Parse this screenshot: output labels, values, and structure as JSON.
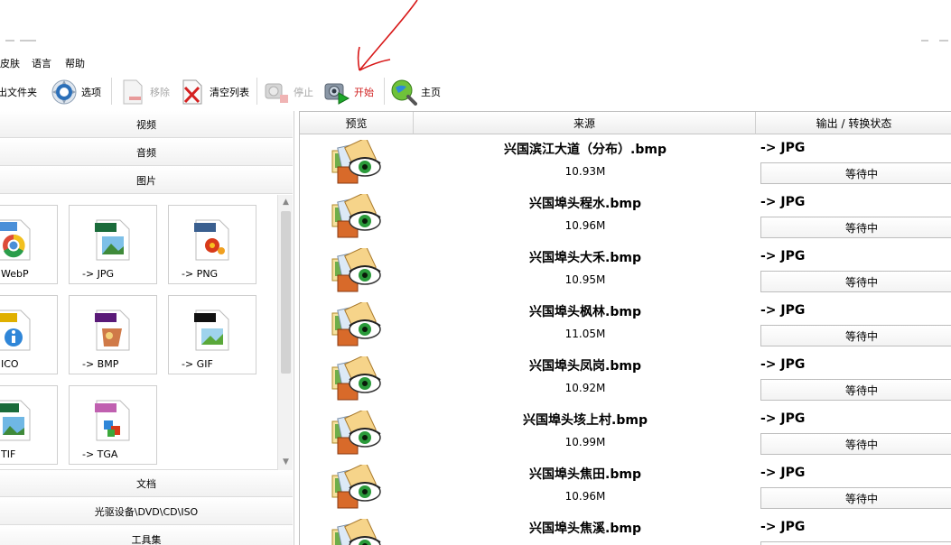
{
  "menu": [
    "皮肤",
    "语言",
    "帮助"
  ],
  "toolbar": {
    "output_folder": "输出文件夹",
    "options": "选项",
    "remove": "移除",
    "clear_list": "清空列表",
    "stop": "停止",
    "start": "开始",
    "home": "主页"
  },
  "left": {
    "categories_top": [
      "视频",
      "音频",
      "图片"
    ],
    "categories_bottom": [
      "文档",
      "光驱设备\\DVD\\CD\\ISO",
      "工具集"
    ],
    "formats": [
      {
        "label": "WebP",
        "badge": "WebP",
        "badge_color": "#4a8fd8"
      },
      {
        "label": "-> JPG",
        "badge": "JPG",
        "badge_color": "#1a6b3a"
      },
      {
        "label": "-> PNG",
        "badge": "PNG",
        "badge_color": "#3a5f8f"
      },
      {
        "label": "ICO",
        "badge": "ICO",
        "badge_color": "#e0b000"
      },
      {
        "label": "-> BMP",
        "badge": "BMP",
        "badge_color": "#5a1a78"
      },
      {
        "label": "-> GIF",
        "badge": "GIF",
        "badge_color": "#111111"
      },
      {
        "label": "TIF",
        "badge": "TIFF",
        "badge_color": "#1a6b3a"
      },
      {
        "label": "-> TGA",
        "badge": "TGA",
        "badge_color": "#c060b0"
      }
    ]
  },
  "table": {
    "headers": [
      "预览",
      "来源",
      "输出 / 转换状态"
    ],
    "rows": [
      {
        "name": "兴国滨江大道（分布）.bmp",
        "size": "10.93M",
        "out": "-> JPG",
        "status": "等待中"
      },
      {
        "name": "兴国埠头程水.bmp",
        "size": "10.96M",
        "out": "-> JPG",
        "status": "等待中"
      },
      {
        "name": "兴国埠头大禾.bmp",
        "size": "10.95M",
        "out": "-> JPG",
        "status": "等待中"
      },
      {
        "name": "兴国埠头枫林.bmp",
        "size": "11.05M",
        "out": "-> JPG",
        "status": "等待中"
      },
      {
        "name": "兴国埠头凤岗.bmp",
        "size": "10.92M",
        "out": "-> JPG",
        "status": "等待中"
      },
      {
        "name": "兴国埠头垓上村.bmp",
        "size": "10.99M",
        "out": "-> JPG",
        "status": "等待中"
      },
      {
        "name": "兴国埠头焦田.bmp",
        "size": "10.96M",
        "out": "-> JPG",
        "status": "等待中"
      },
      {
        "name": "兴国埠头焦溪.bmp",
        "size": "",
        "out": "-> JPG",
        "status": ""
      }
    ]
  }
}
